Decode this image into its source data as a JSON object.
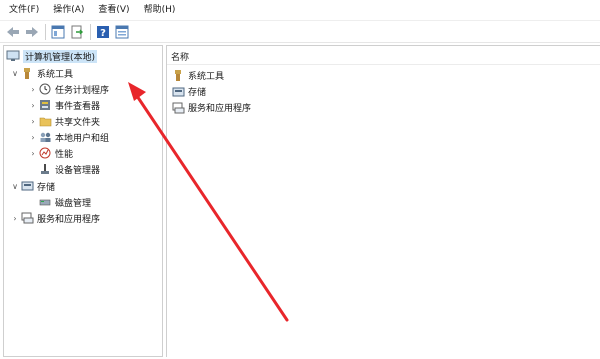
{
  "menu": {
    "file": "文件(F)",
    "action": "操作(A)",
    "view": "查看(V)",
    "help": "帮助(H)"
  },
  "toolbar": {
    "icons": [
      "back-icon",
      "forward-icon",
      "show-hide-tree-icon",
      "export-list-icon",
      "help-icon",
      "properties-icon"
    ]
  },
  "tree": {
    "root": "计算机管理(本地)",
    "system_tools": "系统工具",
    "task_scheduler": "任务计划程序",
    "event_viewer": "事件查看器",
    "shared_folders": "共享文件夹",
    "local_users_groups": "本地用户和组",
    "performance": "性能",
    "device_manager": "设备管理器",
    "storage": "存储",
    "disk_management": "磁盘管理",
    "services_apps": "服务和应用程序"
  },
  "list": {
    "column_name": "名称",
    "items": [
      "系统工具",
      "存储",
      "服务和应用程序"
    ]
  },
  "colors": {
    "selection": "#cce4f7",
    "annotation_arrow": "#e8262b"
  }
}
